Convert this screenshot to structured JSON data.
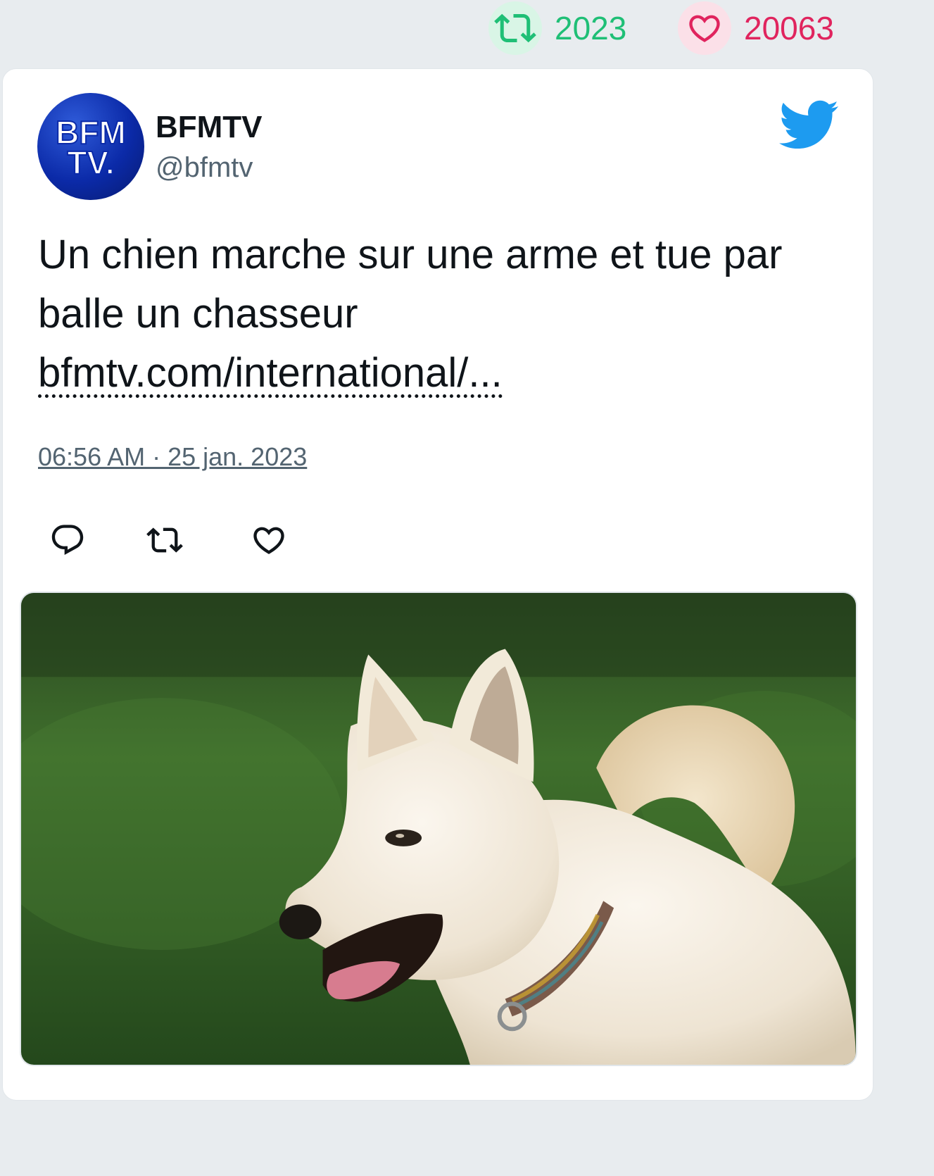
{
  "stats": {
    "retweets": "2023",
    "likes": "20063",
    "retweet_icon": "retweet-icon",
    "like_icon": "heart-icon",
    "retweet_color": "#1fbf76",
    "like_color": "#e0245e"
  },
  "tweet": {
    "avatar_text_line1": "BFM",
    "avatar_text_line2": "TV.",
    "author_name": "BFMTV",
    "author_handle": "@bfmtv",
    "text": "Un chien marche sur une arme et tue par balle un chasseur",
    "link_text": "bfmtv.com/international/...",
    "timestamp": "06:56 AM · 25 jan. 2023",
    "brand_icon": "twitter-bird-icon",
    "brand_color": "#1d9bf0"
  },
  "actions": [
    {
      "name": "reply",
      "icon": "reply-icon"
    },
    {
      "name": "retweet",
      "icon": "retweet-icon"
    },
    {
      "name": "like",
      "icon": "heart-icon"
    }
  ],
  "media": {
    "icon": "photo-white-dog-on-grass"
  }
}
